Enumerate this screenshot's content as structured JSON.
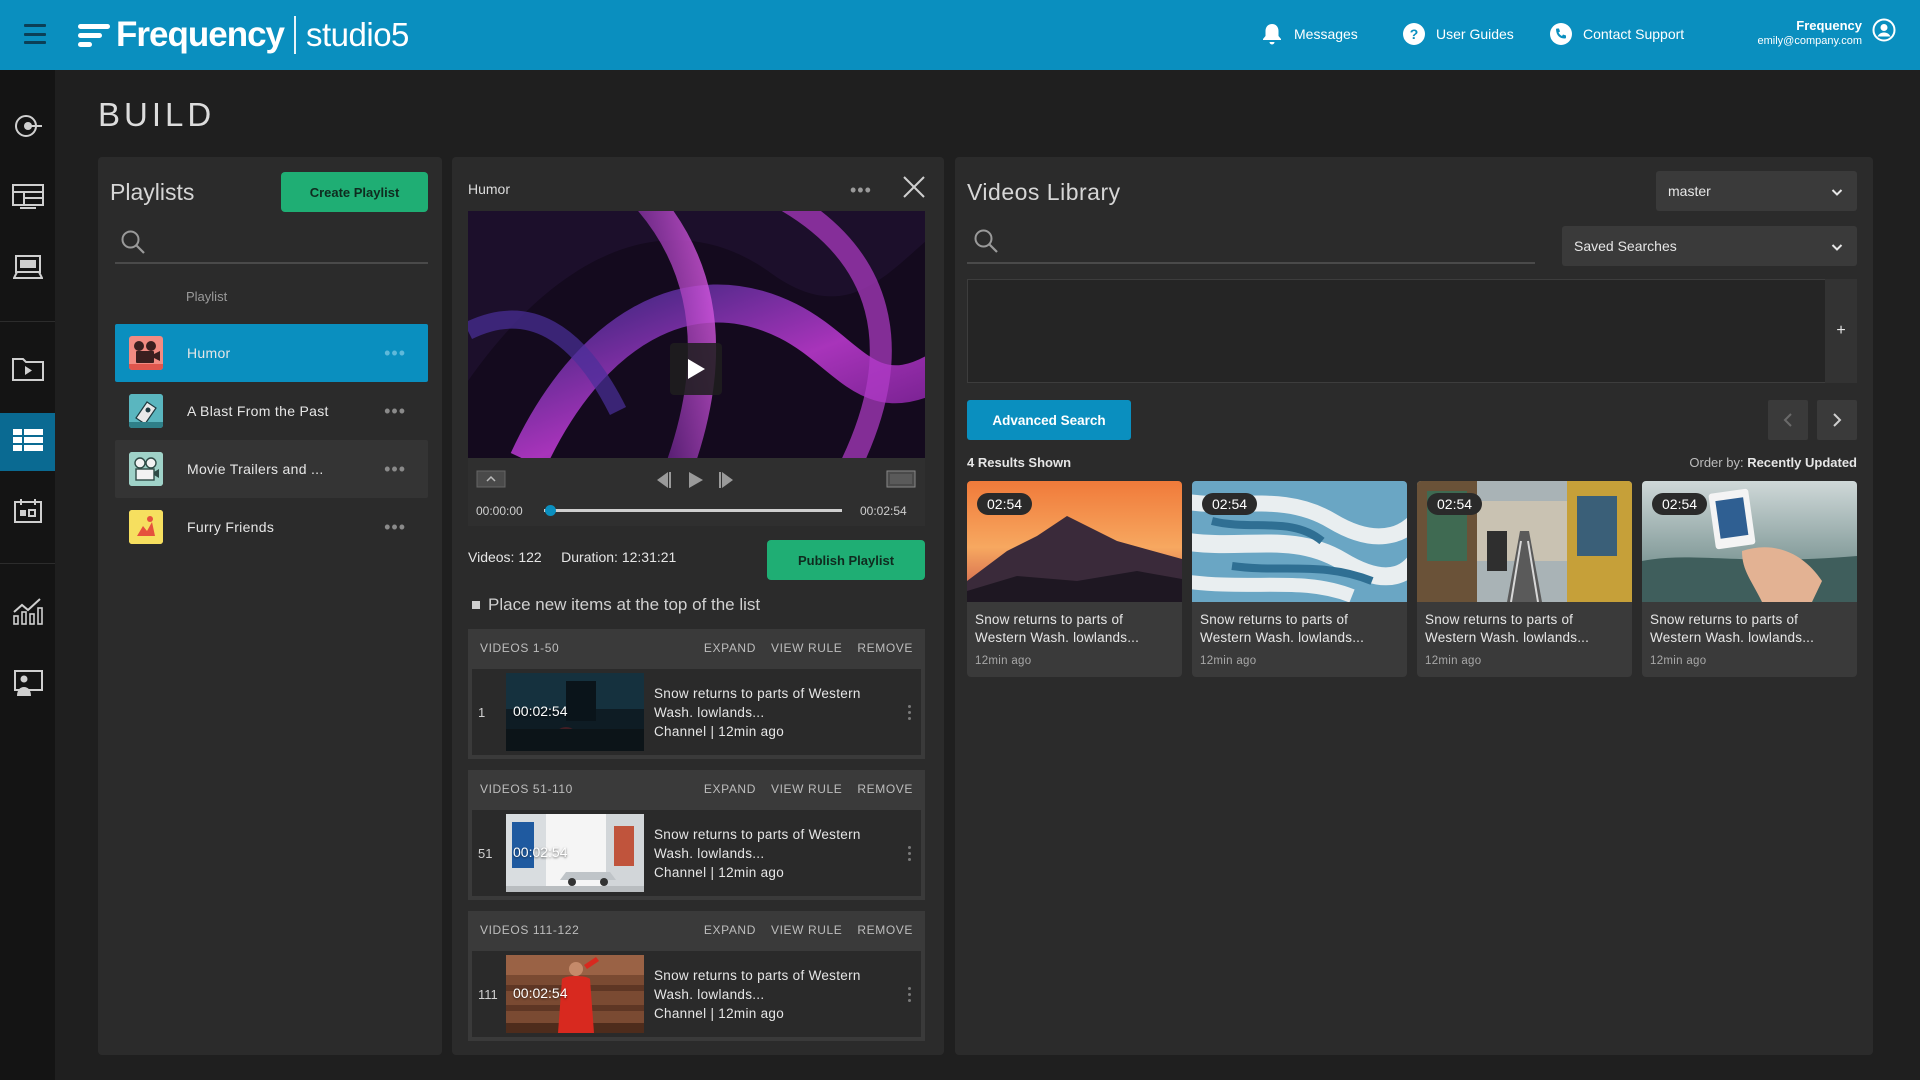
{
  "header": {
    "logo_word": "Frequency",
    "logo_studio": "studio5",
    "messages_label": "Messages",
    "guides_label": "User Guides",
    "support_label": "Contact Support",
    "user_name": "Frequency",
    "user_email": "emily@company.com",
    "bg_color": "#0a8fbf"
  },
  "sidebar": {
    "icons": [
      "record-icon",
      "layout-icon",
      "device-icon",
      "media-folder-icon",
      "playlist-grid-icon",
      "schedule-icon",
      "analytics-icon",
      "presenter-icon"
    ],
    "active": "playlist-grid-icon"
  },
  "page": {
    "title": "BUILD"
  },
  "playlists": {
    "title": "Playlists",
    "create_label": "Create Playlist",
    "column_label": "Playlist",
    "items": [
      {
        "label": "Humor",
        "icon": "film-camera-icon",
        "active": true
      },
      {
        "label": "A Blast From the Past",
        "icon": "ticket-icon",
        "active": false
      },
      {
        "label": "Movie Trailers and ...",
        "icon": "projector-icon",
        "active": false
      },
      {
        "label": "Furry Friends",
        "icon": "dog-icon",
        "active": false
      }
    ]
  },
  "editor": {
    "title": "Humor",
    "time_start": "00:00:00",
    "time_end": "00:02:54",
    "progress": 0.02,
    "stats": "Videos: 122     Duration: 12:31:21",
    "publish_label": "Publish Playlist",
    "place_option": "Place new items at the top of the list",
    "groups": [
      {
        "title": "VIDEOS 1-50",
        "expand": "EXPAND",
        "view_rule": "VIEW RULE",
        "remove": "REMOVE",
        "num": "1",
        "duration": "00:02:54",
        "line1": "Snow returns to parts of Western",
        "line2": "Wash. lowlands...",
        "line3": "Channel | 12min ago"
      },
      {
        "title": "VIDEOS 51-110",
        "expand": "EXPAND",
        "view_rule": "VIEW RULE",
        "remove": "REMOVE",
        "num": "51",
        "duration": "00:02:54",
        "line1": "Snow returns to parts of Western",
        "line2": "Wash. lowlands...",
        "line3": "Channel | 12min ago"
      },
      {
        "title": "VIDEOS 111-122",
        "expand": "EXPAND",
        "view_rule": "VIEW RULE",
        "remove": "REMOVE",
        "num": "111",
        "duration": "00:02:54",
        "line1": "Snow returns to parts of Western",
        "line2": "Wash. lowlands...",
        "line3": "Channel | 12min ago"
      }
    ]
  },
  "library": {
    "title": "Videos Library",
    "branch_select": "master",
    "saved_searches": "Saved Searches",
    "plus": "+",
    "advanced_label": "Advanced Search",
    "results": "4 Results Shown",
    "order_by_label": "Order by:",
    "order_by_value": "Recently Updated",
    "cards": [
      {
        "duration": "02:54",
        "line1": "Snow returns to parts of",
        "line2": "Western Wash. lowlands...",
        "time": "12min ago"
      },
      {
        "duration": "02:54",
        "line1": "Snow returns to parts of",
        "line2": "Western Wash. lowlands...",
        "time": "12min ago"
      },
      {
        "duration": "02:54",
        "line1": "Snow returns to parts of",
        "line2": "Western Wash. lowlands...",
        "time": "12min ago"
      },
      {
        "duration": "02:54",
        "line1": "Snow returns to parts of",
        "line2": "Western Wash. lowlands...",
        "time": "12min ago"
      }
    ]
  }
}
